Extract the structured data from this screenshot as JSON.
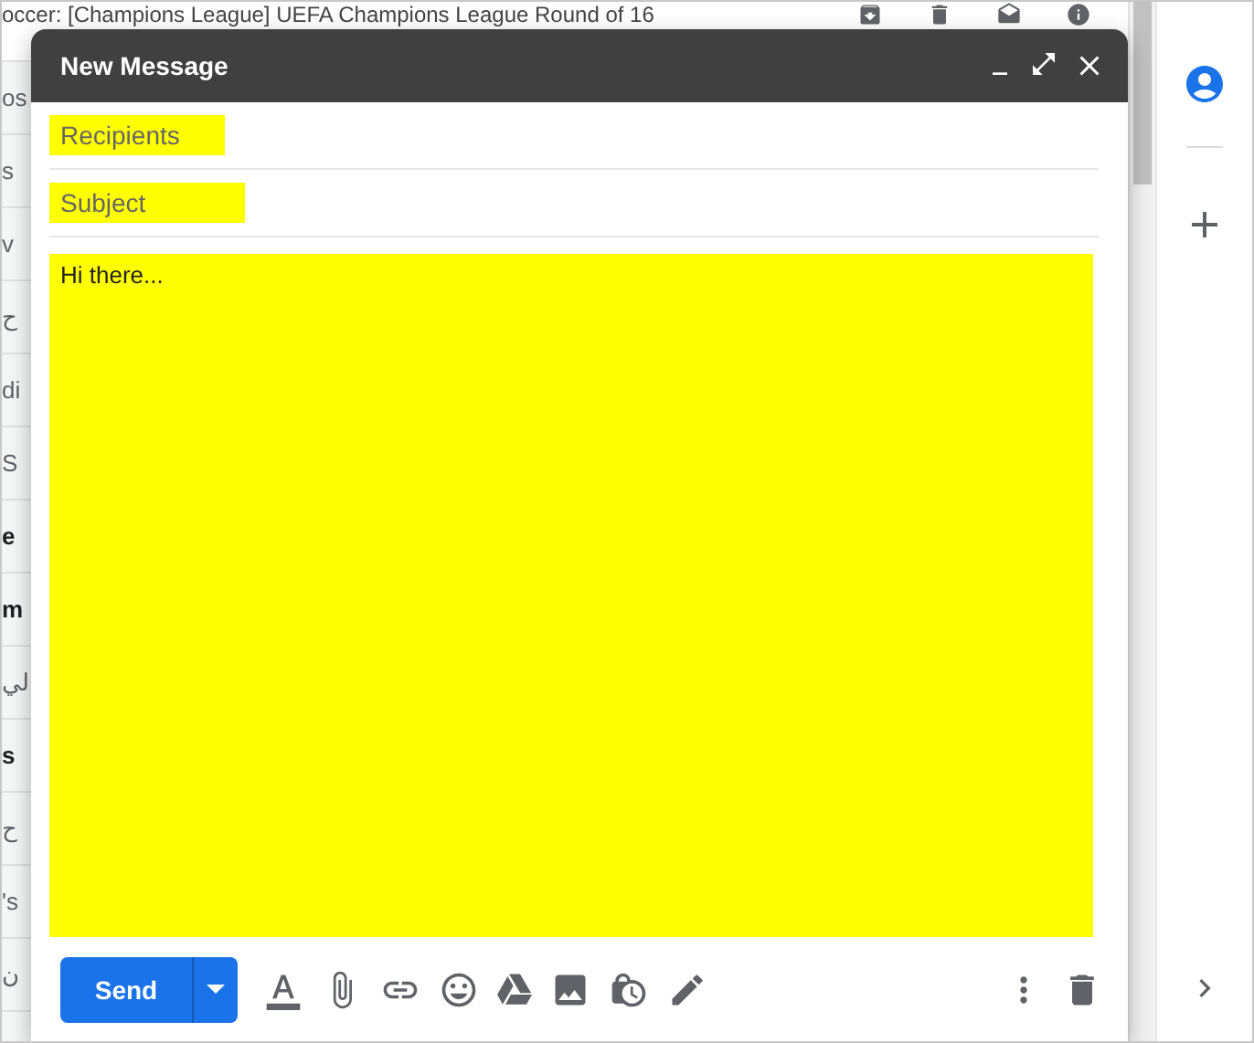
{
  "inbox": {
    "top_row": {
      "subject": "occer: [Champions League] UEFA Champions League Round of 16"
    },
    "rows": [
      {
        "text": "os",
        "unread": false
      },
      {
        "text": "s",
        "unread": false
      },
      {
        "text": "v",
        "unread": false
      },
      {
        "text": "ح",
        "unread": false
      },
      {
        "text": "di",
        "unread": false
      },
      {
        "text": "S",
        "unread": false
      },
      {
        "text": "e",
        "unread": true
      },
      {
        "text": "m",
        "unread": true
      },
      {
        "text": "لي",
        "unread": false
      },
      {
        "text": "s",
        "unread": true
      },
      {
        "text": "ح",
        "unread": false
      },
      {
        "text": "'s",
        "unread": false
      },
      {
        "text": "ن",
        "unread": false
      }
    ]
  },
  "compose": {
    "title": "New Message",
    "recipients": {
      "placeholder": "Recipients"
    },
    "subject": {
      "placeholder": "Subject"
    },
    "body": {
      "value": "Hi there..."
    },
    "send_button": "Send"
  }
}
